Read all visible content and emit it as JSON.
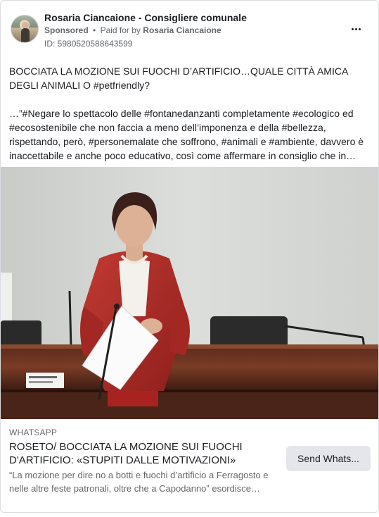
{
  "post": {
    "page_name": "Rosaria Ciancaione - Consigliere comunale",
    "sponsored_label": "Sponsored",
    "separator": "•",
    "paid_for_prefix": "Paid for by",
    "payer": "Rosaria Ciancaione",
    "ad_id": "ID: 5980520588643599",
    "more_icon": "more-options-icon"
  },
  "body": {
    "headline": "BOCCIATA LA MOZIONE SUI FUOCHI D’ARTIFICIO…QUALE CITTÀ AMICA DEGLI ANIMALI O #petfriendly?",
    "text": "…”#Negare lo spettacolo delle #fontanedanzanti completamente #ecologico ed #ecosostenibile che non faccia a meno dell’imponenza e della #bellezza, rispettando, però, #personemalate che soffrono, #animali e #ambiente, davvero è inaccettabile e anche poco educativo, così come affermare in consiglio che in…"
  },
  "link": {
    "domain": "WHATSAPP",
    "title": "ROSETO/ BOCCIATA LA MOZIONE SUI FUOCHI D'ARTIFICIO: «STUPITI DALLE MOTIVAZIONI»",
    "description": "“La mozione per dire no a botti e fuochi d’artificio a Ferragosto e nelle altre feste patronali, oltre che a Capodanno” esordisce…",
    "cta_label": "Send Whats..."
  },
  "colors": {
    "text_primary": "#1c1e21",
    "text_secondary": "#65676b",
    "button_bg": "#e4e6eb",
    "jacket_red": "#b32a2a"
  }
}
